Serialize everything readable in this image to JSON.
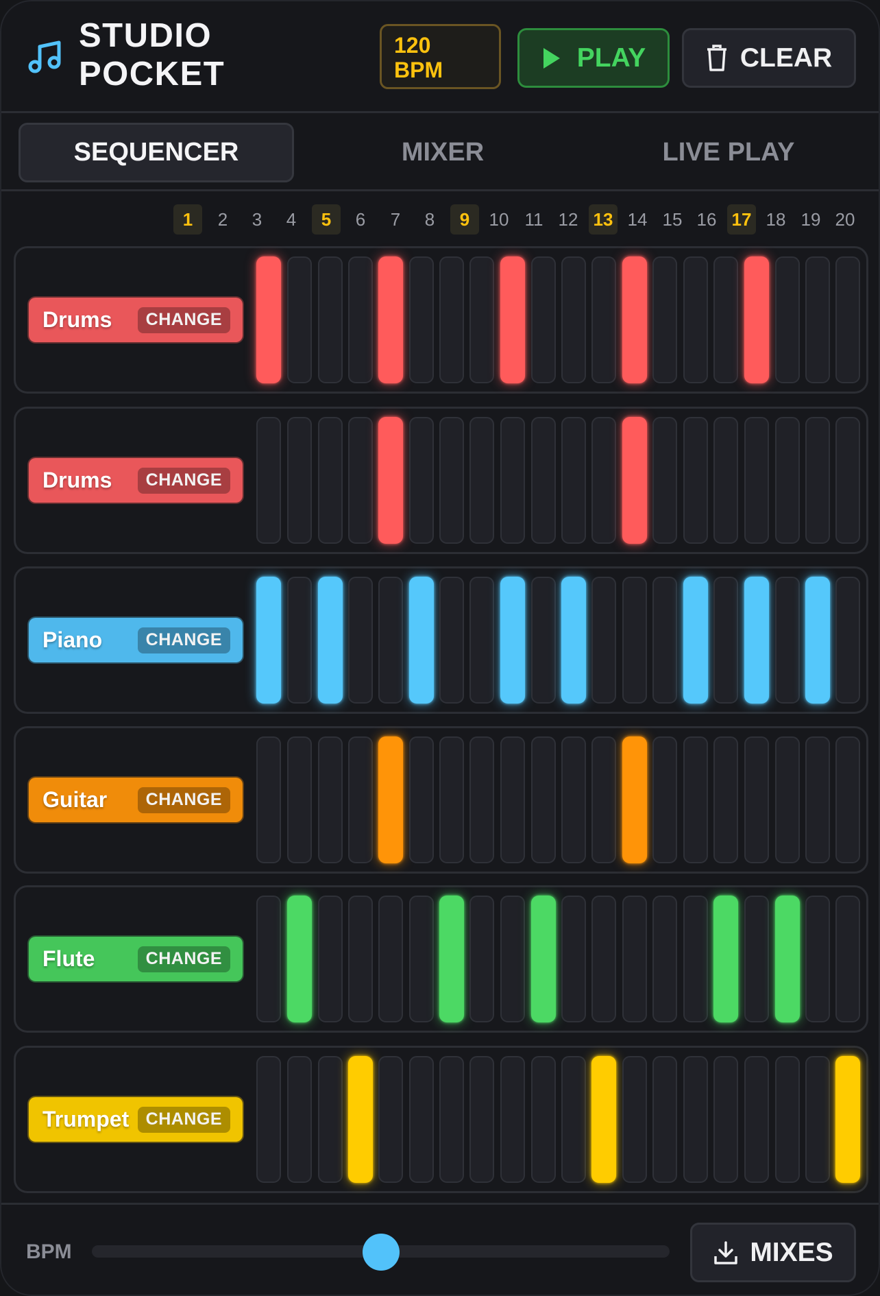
{
  "header": {
    "title_line1": "STUDIO",
    "title_line2": "POCKET",
    "bpm_value": "120",
    "bpm_unit": "BPM",
    "play_label": "PLAY",
    "clear_label": "CLEAR",
    "logo_icon": "music-note-icon"
  },
  "tabs": [
    {
      "label": "SEQUENCER",
      "active": true
    },
    {
      "label": "MIXER",
      "active": false
    },
    {
      "label": "LIVE PLAY",
      "active": false
    }
  ],
  "steps": [
    "1",
    "2",
    "3",
    "4",
    "5",
    "6",
    "7",
    "8",
    "9",
    "10",
    "11",
    "12",
    "13",
    "14",
    "15",
    "16",
    "17",
    "18",
    "19",
    "20"
  ],
  "highlighted_steps": [
    1,
    5,
    9,
    13,
    17
  ],
  "change_label": "CHANGE",
  "tracks": [
    {
      "instrument": "Drums",
      "color": "#ff5b5b",
      "label_color": "#e9575a",
      "pattern": [
        1,
        0,
        0,
        0,
        1,
        0,
        0,
        0,
        1,
        0,
        0,
        0,
        1,
        0,
        0,
        0,
        1,
        0,
        0,
        0
      ]
    },
    {
      "instrument": "Drums",
      "color": "#ff5b5b",
      "label_color": "#e9575a",
      "pattern": [
        0,
        0,
        0,
        0,
        1,
        0,
        0,
        0,
        0,
        0,
        0,
        0,
        1,
        0,
        0,
        0,
        0,
        0,
        0,
        0
      ]
    },
    {
      "instrument": "Piano",
      "color": "#55c8fb",
      "label_color": "#4fb8ec",
      "pattern": [
        1,
        0,
        1,
        0,
        0,
        1,
        0,
        0,
        1,
        0,
        1,
        0,
        0,
        0,
        1,
        0,
        1,
        0,
        1,
        0
      ]
    },
    {
      "instrument": "Guitar",
      "color": "#ff9408",
      "label_color": "#f08c0a",
      "pattern": [
        0,
        0,
        0,
        0,
        1,
        0,
        0,
        0,
        0,
        0,
        0,
        0,
        1,
        0,
        0,
        0,
        0,
        0,
        0,
        0
      ]
    },
    {
      "instrument": "Flute",
      "color": "#4cd964",
      "label_color": "#45c65a",
      "pattern": [
        0,
        1,
        0,
        0,
        0,
        0,
        1,
        0,
        0,
        1,
        0,
        0,
        0,
        0,
        0,
        1,
        0,
        1,
        0,
        0
      ]
    },
    {
      "instrument": "Trumpet",
      "color": "#ffcc00",
      "label_color": "#f0c400",
      "pattern": [
        0,
        0,
        0,
        1,
        0,
        0,
        0,
        0,
        0,
        0,
        0,
        1,
        0,
        0,
        0,
        0,
        0,
        0,
        0,
        1
      ]
    }
  ],
  "footer": {
    "bpm_label": "BPM",
    "slider_value_fraction": 0.5,
    "mixes_label": "MIXES"
  }
}
